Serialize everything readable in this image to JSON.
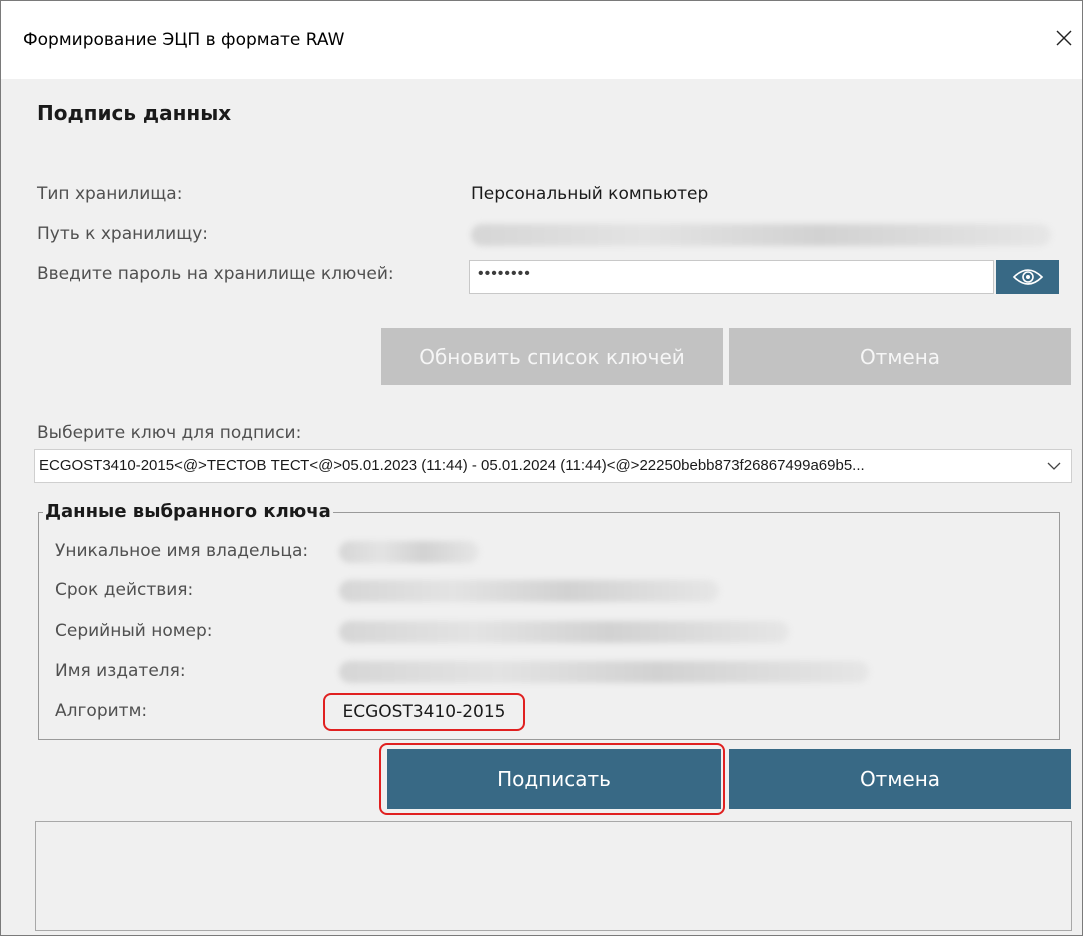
{
  "window": {
    "title": "Формирование ЭЦП в формате RAW"
  },
  "main": {
    "heading": "Подпись данных",
    "storage_type_label": "Тип хранилища:",
    "storage_type_value": "Персональный компьютер",
    "storage_path_label": "Путь к хранилищу:",
    "password_label": "Введите пароль на хранилище ключей:",
    "password_value": "••••••••",
    "refresh_keys_button": "Обновить список ключей",
    "cancel_top_button": "Отмена",
    "select_key_label": "Выберите ключ для подписи:",
    "selected_key": "ECGOST3410-2015<@>ТЕСТОВ ТЕСТ<@>05.01.2023 (11:44) - 05.01.2024 (11:44)<@>22250bebb873f26867499a69b5...",
    "sign_button": "Подписать",
    "cancel_bottom_button": "Отмена"
  },
  "key_details": {
    "group_title": "Данные выбранного ключа",
    "owner_label": "Уникальное имя владельца:",
    "validity_label": "Срок действия:",
    "serial_label": "Серийный номер:",
    "issuer_label": "Имя издателя:",
    "algorithm_label": "Алгоритм:",
    "algorithm_value": "ECGOST3410-2015"
  },
  "colors": {
    "accent": "#386985",
    "disabled_button": "#c2c2c2",
    "highlight": "#e02020"
  }
}
